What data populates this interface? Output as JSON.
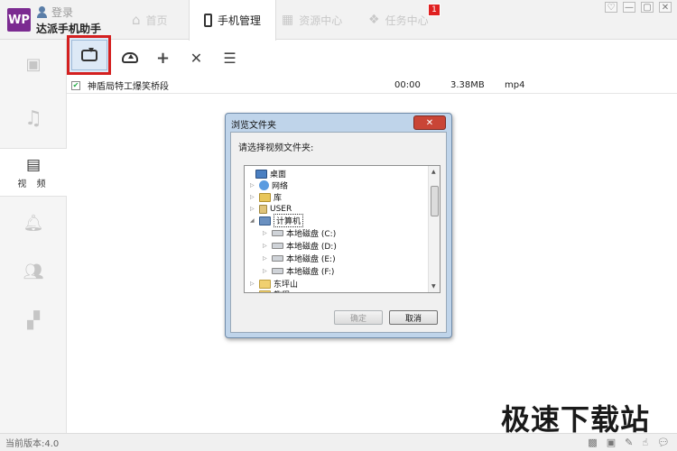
{
  "header": {
    "logo_text": "WP",
    "login_label": "登录",
    "app_name": "达派手机助手",
    "tabs": [
      {
        "label": "首页",
        "icon": "home-icon"
      },
      {
        "label": "手机管理",
        "icon": "phone-icon",
        "active": true
      },
      {
        "label": "资源中心",
        "icon": "grid-icon"
      },
      {
        "label": "任务中心",
        "icon": "layers-icon"
      }
    ],
    "task_badge": "1",
    "window_controls": [
      "♡",
      "—",
      "▢",
      "✕"
    ]
  },
  "sidebar": {
    "items": [
      {
        "icon": "photo-icon",
        "label": ""
      },
      {
        "icon": "music-icon",
        "label": ""
      },
      {
        "icon": "video-icon",
        "label": "视 频",
        "active": true
      },
      {
        "icon": "bell-icon",
        "label": ""
      },
      {
        "icon": "contacts-icon",
        "label": ""
      },
      {
        "icon": "apps-icon",
        "label": ""
      }
    ]
  },
  "toolbar": {
    "import_icon": "import-tray-icon",
    "export_icon": "cloud-upload-icon",
    "add_glyph": "+",
    "delete_glyph": "✕",
    "select_glyph": "☰"
  },
  "files": [
    {
      "name": "神盾局特工爆笑桥段",
      "duration": "00:00",
      "size": "3.38MB",
      "format": "mp4",
      "checked": true
    }
  ],
  "dialog": {
    "title": "浏览文件夹",
    "close_glyph": "✕",
    "prompt": "请选择视频文件夹:",
    "tree": [
      {
        "label": "桌面",
        "icon": "desktop-icon",
        "level": 0,
        "twisty": ""
      },
      {
        "label": "网络",
        "icon": "network-icon",
        "level": 1,
        "twisty": "▷"
      },
      {
        "label": "库",
        "icon": "library-icon",
        "level": 1,
        "twisty": "▷"
      },
      {
        "label": "USER",
        "icon": "user-folder-icon",
        "level": 1,
        "twisty": "▷"
      },
      {
        "label": "计算机",
        "icon": "computer-icon",
        "level": 1,
        "twisty": "◢",
        "selected": true
      },
      {
        "label": "本地磁盘 (C:)",
        "icon": "system-drive-icon",
        "level": 2,
        "twisty": "▷"
      },
      {
        "label": "本地磁盘 (D:)",
        "icon": "drive-icon",
        "level": 2,
        "twisty": "▷"
      },
      {
        "label": "本地磁盘 (E:)",
        "icon": "drive-icon",
        "level": 2,
        "twisty": "▷"
      },
      {
        "label": "本地磁盘 (F:)",
        "icon": "drive-icon",
        "level": 2,
        "twisty": "▷"
      },
      {
        "label": "东坪山",
        "icon": "folder-icon",
        "level": 1,
        "twisty": "▷"
      },
      {
        "label": "教程",
        "icon": "folder-icon",
        "level": 1,
        "twisty": "▷"
      }
    ],
    "ok_label": "确定",
    "cancel_label": "取消"
  },
  "statusbar": {
    "version": "当前版本:4.0",
    "icons": [
      "qrcode-icon",
      "feedback-icon",
      "edit-icon",
      "hand-icon",
      "chat-icon"
    ]
  },
  "watermark": "极速下载站"
}
